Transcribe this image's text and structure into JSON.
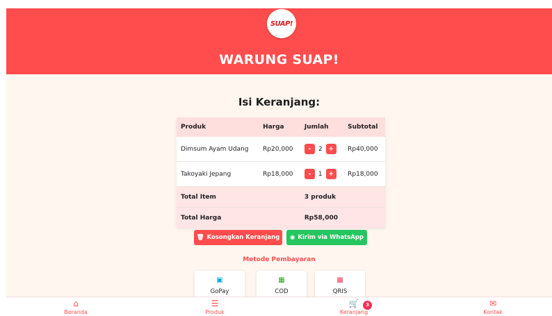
{
  "header": {
    "logo_text": "SUAP!",
    "store_title": "WARUNG SUAP!"
  },
  "cart": {
    "title": "Isi Keranjang:",
    "columns": [
      "Produk",
      "Harga",
      "Jumlah",
      "Subtotal"
    ],
    "items": [
      {
        "name": "Dimsum Ayam Udang",
        "price": "Rp20,000",
        "qty": "2",
        "subtotal": "Rp40,000"
      },
      {
        "name": "Takoyaki Jepang",
        "price": "Rp18,000",
        "qty": "1",
        "subtotal": "Rp18,000"
      }
    ],
    "summary": {
      "total_item_label": "Total Item",
      "total_item_value": "3 produk",
      "total_price_label": "Total Harga",
      "total_price_value": "Rp58,000"
    },
    "button_minus": "-",
    "button_plus": "+"
  },
  "actions": {
    "empty_label": "Kosongkan Keranjang",
    "whatsapp_label": "Kirim via WhatsApp"
  },
  "payment": {
    "title": "Metode Pembayaran",
    "methods": [
      "GoPay",
      "COD",
      "QRIS"
    ]
  },
  "nav": {
    "items": [
      "Beranda",
      "Produk",
      "Keranjang",
      "Kontak"
    ],
    "cart_badge": "3"
  },
  "colors": {
    "primary": "#ff4d4d",
    "whatsapp": "#25c55f",
    "background": "#fff7ef"
  }
}
